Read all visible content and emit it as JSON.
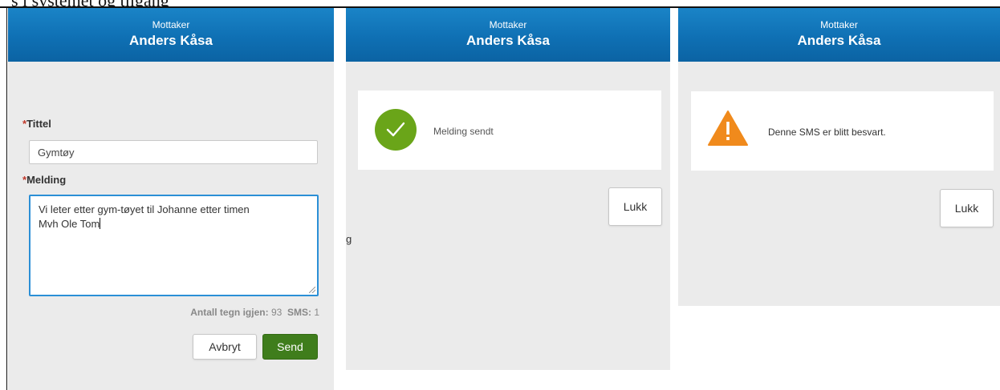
{
  "top_fragment": "s i systemet og tilgang",
  "panels": [
    {
      "header": {
        "subtitle": "Mottaker",
        "name": "Anders Kåsa"
      },
      "form": {
        "title_label": "Tittel",
        "title_value": "Gymtøy",
        "message_label": "Melding",
        "message_lines": [
          "Vi leter etter gym-tøyet til Johanne etter timen",
          "Mvh Ole Tom"
        ],
        "counter_label": "Antall tegn igjen:",
        "counter_value": "93",
        "sms_label": "SMS:",
        "sms_value": "1",
        "required_mark": "*"
      },
      "buttons": {
        "cancel": "Avbryt",
        "send": "Send"
      }
    },
    {
      "header": {
        "subtitle": "Mottaker",
        "name": "Anders Kåsa"
      },
      "status": {
        "icon": "check-circle-icon",
        "text": "Melding sendt",
        "color": "#6aa519"
      },
      "close_label": "Lukk"
    },
    {
      "header": {
        "subtitle": "Mottaker",
        "name": "Anders Kåsa"
      },
      "status": {
        "icon": "warning-triangle-icon",
        "text": "Denne SMS er blitt besvart.",
        "color": "#f08a1c"
      },
      "close_label": "Lukk"
    }
  ],
  "stray_char": "g",
  "colors": {
    "header_blue": "#0f70b4",
    "send_green": "#3f7d1c",
    "focus_blue": "#2b8fd6",
    "required_red": "#c0392b"
  }
}
